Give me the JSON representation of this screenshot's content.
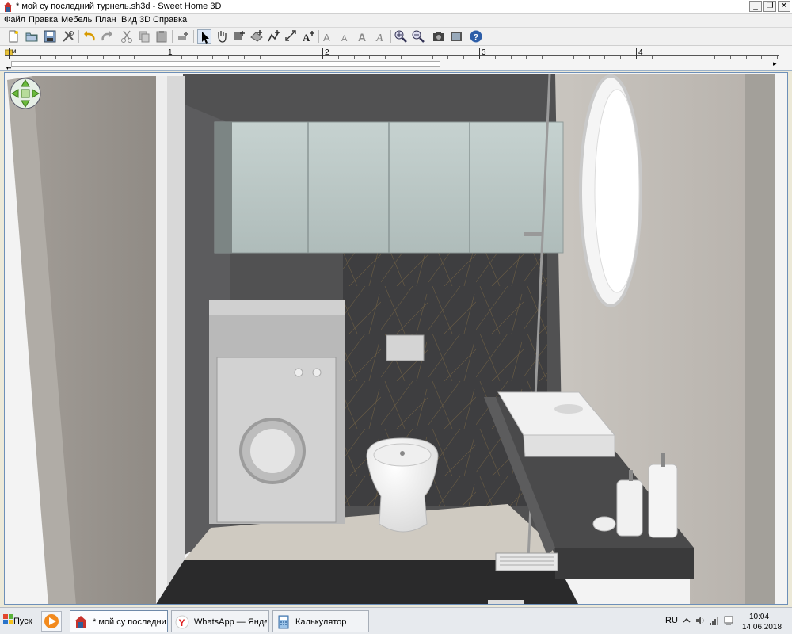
{
  "window": {
    "title": "* мой су последний турнель.sh3d - Sweet Home 3D",
    "minimize_label": "_",
    "restore_label": "❐",
    "close_label": "✕"
  },
  "menu": [
    "Файл",
    "Правка",
    "Мебель",
    "План",
    "Вид 3D",
    "Справка"
  ],
  "toolbar": {
    "icons": [
      "new-icon",
      "open-icon",
      "save-icon",
      "preferences-icon",
      "undo-icon",
      "redo-icon",
      "cut-icon",
      "copy-icon",
      "paste-icon",
      "add-furniture-icon",
      "select-mode-icon",
      "pan-mode-icon",
      "create-walls-icon",
      "create-rooms-icon",
      "create-polylines-icon",
      "create-dimensions-icon",
      "add-text-icon",
      "increase-text-icon",
      "decrease-text-icon",
      "bold-text-icon",
      "italic-text-icon",
      "zoom-in-icon",
      "zoom-out-icon",
      "create-photo-icon",
      "create-video-icon",
      "help-icon"
    ]
  },
  "ruler": {
    "unit": "м",
    "labels": [
      "1",
      "2",
      "3",
      "4"
    ]
  },
  "taskbar": {
    "start_label": "Пуск",
    "tasks": [
      {
        "label": "* мой су последни...",
        "icon": "sweet-home-3d-icon"
      },
      {
        "label": "WhatsApp — Яндек...",
        "icon": "yandex-browser-icon"
      },
      {
        "label": "Калькулятор",
        "icon": "calculator-icon"
      }
    ],
    "language": "RU",
    "time": "10:04",
    "date": "14.06.2018"
  },
  "colors": {
    "accent": "#3a6ea5",
    "wall_light": "#b8b4ae",
    "tile_dark": "#3f3f40",
    "cabinet_glass": "#b5c3c1",
    "floor": "#cfcac1"
  }
}
